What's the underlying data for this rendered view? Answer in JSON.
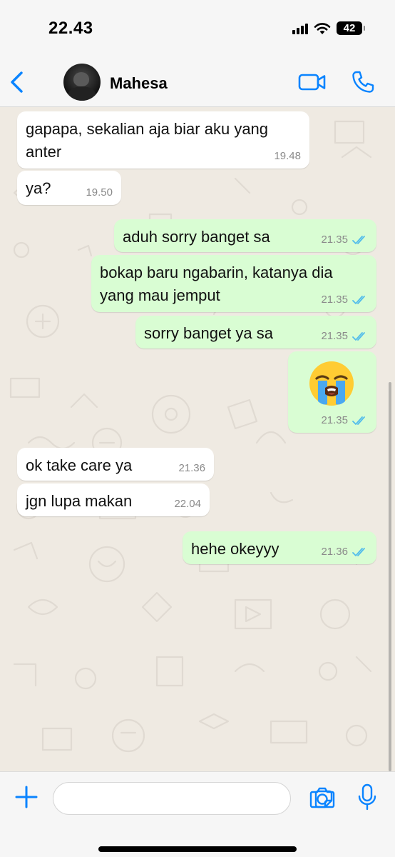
{
  "status_bar": {
    "time": "22.43",
    "battery": "42",
    "icons": [
      "signal-icon",
      "wifi-icon",
      "battery-icon"
    ]
  },
  "header": {
    "contact_name": "Mahesa",
    "icons": [
      "back-chevron-icon",
      "video-camera-icon",
      "phone-icon"
    ],
    "accent_color": "#0a84ff"
  },
  "messages": [
    {
      "direction": "in",
      "lines": [
        "gapapa, sekalian aja biar aku yang",
        "anter"
      ],
      "time": "19.48"
    },
    {
      "direction": "in",
      "lines": [
        "ya?"
      ],
      "time": "19.50"
    },
    {
      "direction": "out",
      "lines": [
        "aduh sorry banget sa"
      ],
      "time": "21.35",
      "status": "read"
    },
    {
      "direction": "out",
      "lines": [
        "bokap baru ngabarin, katanya dia",
        "yang mau jemput"
      ],
      "time": "21.35",
      "status": "read"
    },
    {
      "direction": "out",
      "lines": [
        "sorry banget ya sa"
      ],
      "time": "21.35",
      "status": "read"
    },
    {
      "direction": "out",
      "emoji": "loudly-crying-face",
      "time": "21.35",
      "status": "read"
    },
    {
      "direction": "in",
      "lines": [
        "ok take care ya"
      ],
      "time": "21.36"
    },
    {
      "direction": "in",
      "lines": [
        "jgn lupa makan"
      ],
      "time": "22.04"
    },
    {
      "direction": "out",
      "lines": [
        "hehe okeyyy"
      ],
      "time": "21.36",
      "status": "read"
    }
  ],
  "input_bar": {
    "placeholder": "",
    "icons": [
      "plus-icon",
      "sticker-icon",
      "camera-icon",
      "microphone-icon"
    ]
  },
  "colors": {
    "incoming_bubble": "#ffffff",
    "outgoing_bubble": "#d9fdd3",
    "chat_background": "#efeae2",
    "read_ticks": "#53bdeb"
  }
}
